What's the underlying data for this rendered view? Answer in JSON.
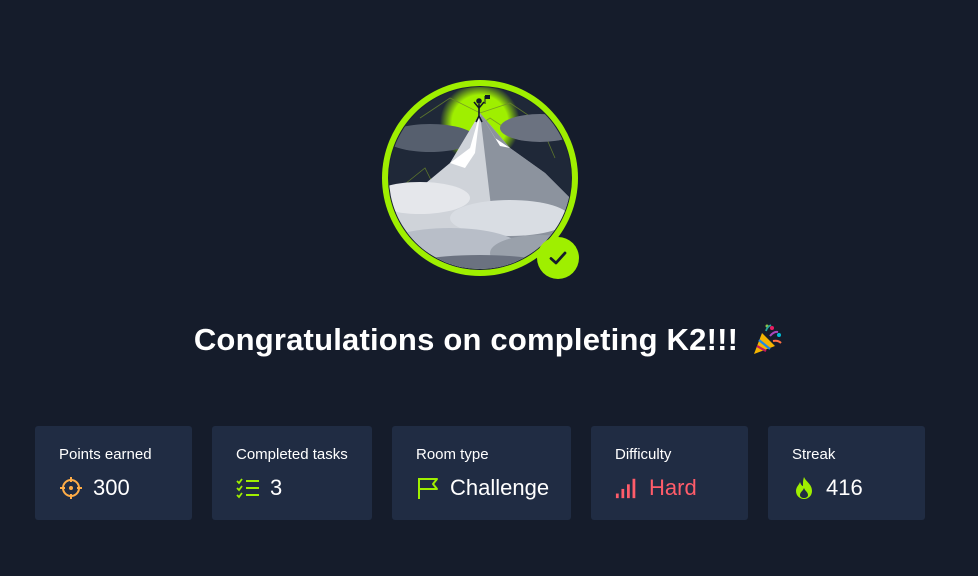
{
  "title": "Congratulations on completing K2!!!",
  "colors": {
    "accent": "#9fef00",
    "background": "#151c2b",
    "card": "#202c43",
    "hard": "#ff5c6a",
    "points": "#ffad47"
  },
  "stats": [
    {
      "label": "Points earned",
      "value": "300",
      "icon": "target-icon"
    },
    {
      "label": "Completed tasks",
      "value": "3",
      "icon": "checklist-icon"
    },
    {
      "label": "Room type",
      "value": "Challenge",
      "icon": "flag-icon"
    },
    {
      "label": "Difficulty",
      "value": "Hard",
      "icon": "signal-bars-icon"
    },
    {
      "label": "Streak",
      "value": "416",
      "icon": "flame-icon"
    }
  ],
  "badge": {
    "icon": "mountain-badge-icon",
    "completed_icon": "checkmark-icon",
    "emoji": "party-popper-icon"
  }
}
